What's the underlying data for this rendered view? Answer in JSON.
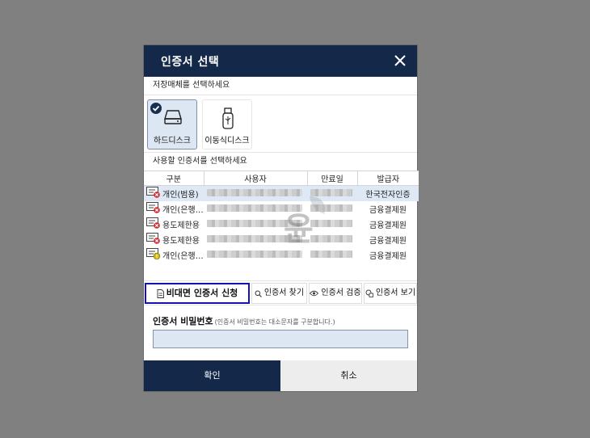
{
  "dialog": {
    "title": "인증서 선택",
    "close_icon": "close-icon"
  },
  "media": {
    "label": "저장매체를 선택하세요",
    "items": [
      {
        "label": "하드디스크",
        "icon": "hard-disk-icon",
        "selected": true
      },
      {
        "label": "이동식디스크",
        "icon": "usb-drive-icon",
        "selected": false
      }
    ]
  },
  "certs": {
    "label": "사용할 인증서를 선택하세요",
    "columns": [
      "구분",
      "사용자",
      "만료일",
      "발급자"
    ],
    "rows": [
      {
        "type": "개인(범용)",
        "issuer": "한국전자인증",
        "status": "error",
        "selected": true
      },
      {
        "type": "개인(은행…",
        "issuer": "금융결제원",
        "status": "error",
        "selected": false
      },
      {
        "type": "용도제한용",
        "issuer": "금융결제원",
        "status": "error",
        "selected": false
      },
      {
        "type": "용도제한용",
        "issuer": "금융결제원",
        "status": "error",
        "selected": false
      },
      {
        "type": "개인(은행…",
        "issuer": "금융결제원",
        "status": "warning",
        "selected": false
      }
    ]
  },
  "toolbar": {
    "apply_label": "비대면 인증서 신청",
    "find_label": "인증서 찾기",
    "verify_label": "인증서 검증",
    "view_label": "인증서 보기"
  },
  "password": {
    "label": "인증서 비밀번호",
    "hint": "(인증서 비밀번호는 대소문자를 구분합니다.)",
    "value": ""
  },
  "footer": {
    "ok_label": "확인",
    "cancel_label": "취소"
  },
  "colors": {
    "header_bg": "#14294a",
    "selected_bg": "#dde6f3",
    "primary_border": "#1212b5",
    "error_red": "#d7262b",
    "warning_yellow": "#e0b400"
  }
}
